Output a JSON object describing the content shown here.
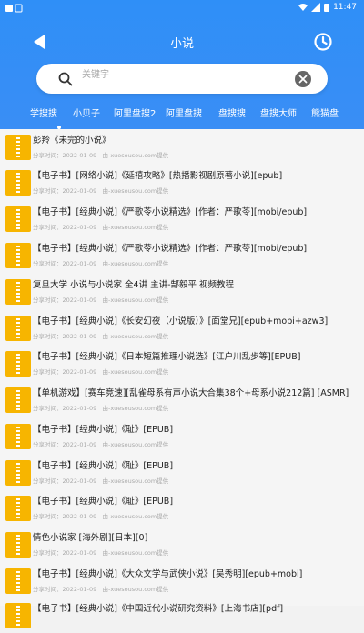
{
  "status": {
    "time": "11:47"
  },
  "header": {
    "title": "小说"
  },
  "search": {
    "placeholder": "关键字"
  },
  "tabs": [
    "学搜搜",
    "小贝子",
    "阿里盘搜2",
    "阿里盘搜",
    "盘搜搜",
    "盘搜大师",
    "熊猫盘"
  ],
  "items": [
    {
      "title": "彭羚《未完的小说》",
      "date": "分享时间：2022-01-09",
      "source": "由-xuesousou.com提供"
    },
    {
      "title": "【电子书】[网络小说]《延禧攻略》[热播影视剧原著小说][epub]",
      "date": "分享时间：2022-01-09",
      "source": "由-xuesousou.com提供"
    },
    {
      "title": "【电子书】[经典小说]《严歌苓小说精选》[作者：严歌苓][mobi/epub]",
      "date": "分享时间：2022-01-09",
      "source": "由-xuesousou.com提供"
    },
    {
      "title": "【电子书】[经典小说]《严歌苓小说精选》[作者：严歌苓][mobi/epub]",
      "date": "分享时间：2022-01-09",
      "source": "由-xuesousou.com提供"
    },
    {
      "title": "复旦大学 小说与小说家 全4讲 主讲-郜毅平 视频教程",
      "date": "分享时间：2022-01-09",
      "source": "由-xuesousou.com提供"
    },
    {
      "title": "【电子书】[经典小说]《长安幻夜（小说版）》[面堂兄][epub+mobi+azw3]",
      "date": "分享时间：2022-01-09",
      "source": "由-xuesousou.com提供"
    },
    {
      "title": "【电子书】[经典小说]《日本短篇推理小说选》[江户川乱步等][EPUB]",
      "date": "分享时间：2022-01-09",
      "source": "由-xuesousou.com提供"
    },
    {
      "title": "【单机游戏】[赛车竞速][乱雀母系有声小说大合集38个+母系小说212篇] [ASMR]",
      "date": "分享时间：2022-01-09",
      "source": "由-xuesousou.com提供"
    },
    {
      "title": "【电子书】[经典小说]《耻》[EPUB]",
      "date": "分享时间：2022-01-09",
      "source": "由-xuesousou.com提供"
    },
    {
      "title": "【电子书】[经典小说]《耻》[EPUB]",
      "date": "分享时间：2022-01-09",
      "source": "由-xuesousou.com提供"
    },
    {
      "title": "【电子书】[经典小说]《耻》[EPUB]",
      "date": "分享时间：2022-01-09",
      "source": "由-xuesousou.com提供"
    },
    {
      "title": "情色小说家 [海外剧][日本][0]",
      "date": "分享时间：2022-01-09",
      "source": "由-xuesousou.com提供"
    },
    {
      "title": "【电子书】[经典小说]《大众文学与武侠小说》[吴秀明][epub+mobi]",
      "date": "分享时间：2022-01-09",
      "source": "由-xuesousou.com提供"
    },
    {
      "title": "【电子书】[经典小说]《中国近代小说研究资料》[上海书店][pdf]",
      "date": "",
      "source": ""
    }
  ]
}
